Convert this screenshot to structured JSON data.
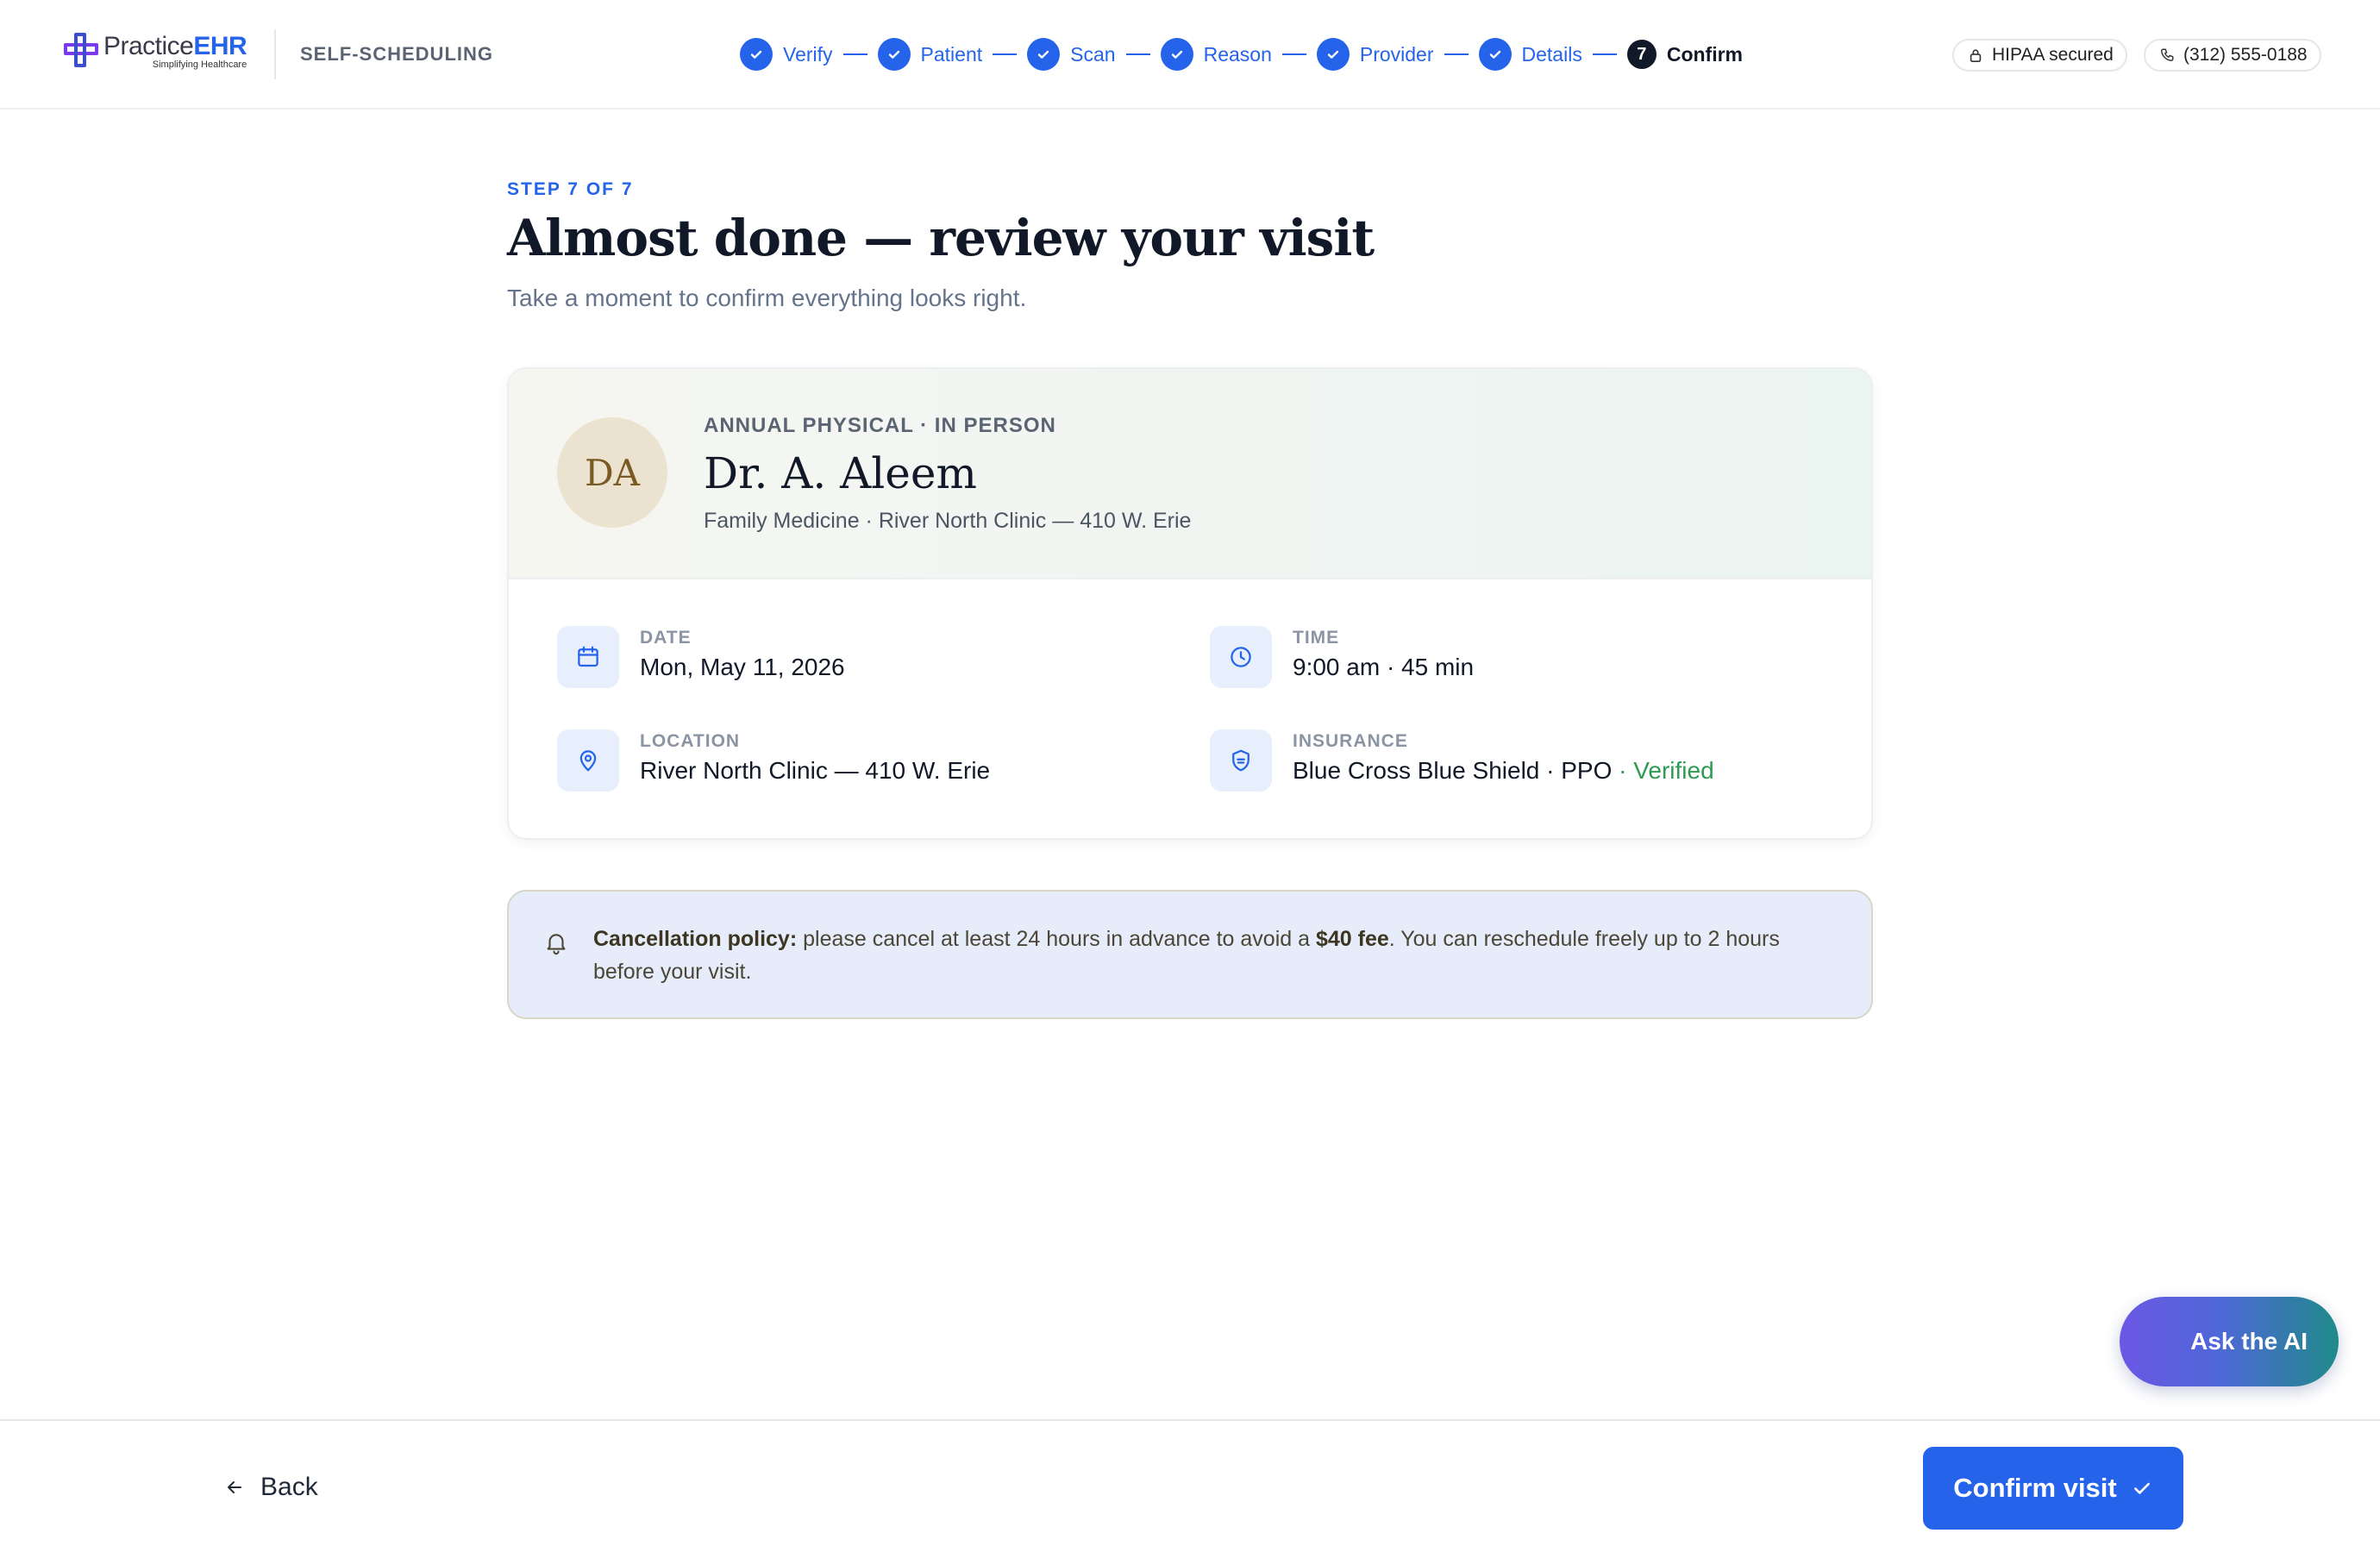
{
  "header": {
    "logo": {
      "word_plain": "Practice",
      "word_bold": "EHR",
      "tagline": "Simplifying Healthcare"
    },
    "app_label": "SELF-SCHEDULING",
    "steps": [
      {
        "label": "Verify",
        "state": "done"
      },
      {
        "label": "Patient",
        "state": "done"
      },
      {
        "label": "Scan",
        "state": "done"
      },
      {
        "label": "Reason",
        "state": "done"
      },
      {
        "label": "Provider",
        "state": "done"
      },
      {
        "label": "Details",
        "state": "done"
      },
      {
        "label": "Confirm",
        "state": "current",
        "number": "7"
      }
    ],
    "hipaa_label": "HIPAA secured",
    "phone_label": "(312) 555-0188"
  },
  "main": {
    "step_kicker": "STEP 7 OF 7",
    "title": "Almost done — review your visit",
    "subtitle": "Take a moment to confirm everything looks right."
  },
  "summary": {
    "avatar_initials": "DA",
    "visit_type": "ANNUAL PHYSICAL · IN PERSON",
    "provider_name": "Dr. A. Aleem",
    "provider_meta": "Family Medicine · River North Clinic — 410 W. Erie",
    "date": {
      "label": "DATE",
      "value": "Mon, May 11, 2026",
      "icon": "calendar-icon"
    },
    "time": {
      "label": "TIME",
      "value": "9:00 am · 45 min",
      "icon": "clock-icon"
    },
    "location": {
      "label": "LOCATION",
      "value": "River North Clinic — 410 W. Erie",
      "icon": "map-pin-icon"
    },
    "insurance": {
      "label": "INSURANCE",
      "value": "Blue Cross Blue Shield · PPO",
      "status": " · Verified",
      "icon": "shield-icon"
    }
  },
  "policy": {
    "icon": "bell-icon",
    "heading": "Cancellation policy:",
    "text_before": " please cancel at least 24 hours in advance to avoid a ",
    "fee": "$40 fee",
    "text_after": ". You can reschedule freely up to 2 hours before your visit."
  },
  "ask_ai_label": "Ask the AI",
  "footer": {
    "back_label": "Back",
    "confirm_label": "Confirm visit"
  },
  "colors": {
    "accent": "#2563eb",
    "verified": "#2e9a52",
    "policy_bg": "#e6ecfa",
    "avatar_bg": "#ebe2cf"
  }
}
